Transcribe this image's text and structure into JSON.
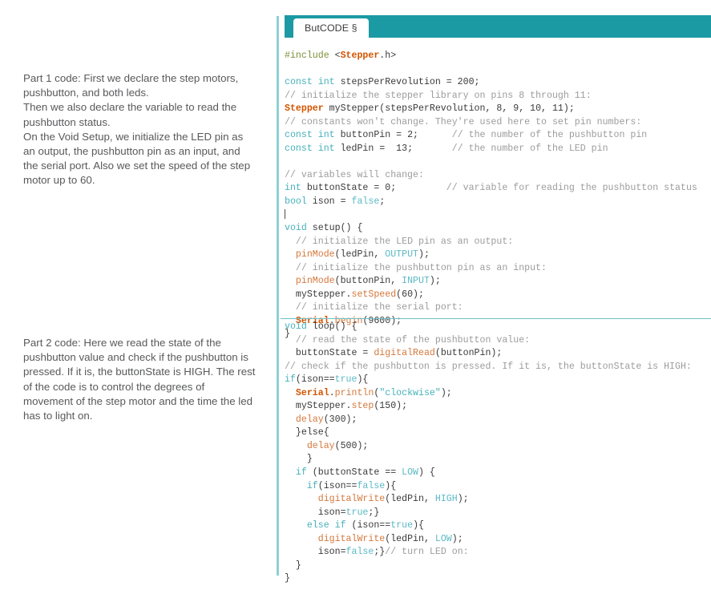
{
  "notes": {
    "part1": "Part 1 code: First we declare the step motors, pushbutton, and both leds.\nThen we also declare the variable to read the pushbutton status.\nOn the Void Setup, we initialize the LED pin as an output, the pushbutton pin as an input, and the serial port. Also we set the speed of the step motor up to 60.",
    "part2": "Part 2 code: Here we read the state of the pushbutton value and check if the pushbutton is pressed. If it is, the buttonState is HIGH. The rest of the code is to control the degrees of movement of the step motor and the time the led has to light on."
  },
  "tabs": {
    "active_label": "ButCODE §"
  },
  "colors": {
    "tab_bar": "#1b9aa3",
    "rail": "#8ecfd6",
    "divider": "#6cc0c5",
    "keyword": "#46b1bb",
    "type": "#d35400",
    "function": "#d4783c",
    "constant": "#5bb9c4",
    "string": "#46b1bb",
    "comment": "#9c9c9c",
    "preprocessor": "#7a8f3a",
    "text": "#3a3a3a",
    "note_text": "#58595b"
  },
  "code_block_1": [
    [
      {
        "t": "pre",
        "v": "#include "
      },
      {
        "t": "plain",
        "v": "<"
      },
      {
        "t": "type",
        "v": "Stepper"
      },
      {
        "t": "plain",
        "v": ".h>"
      }
    ],
    [],
    [
      {
        "t": "kw",
        "v": "const int"
      },
      {
        "t": "plain",
        "v": " stepsPerRevolution = 200;"
      }
    ],
    [
      {
        "t": "cmt",
        "v": "// initialize the stepper library on pins 8 through 11:"
      }
    ],
    [
      {
        "t": "type",
        "v": "Stepper"
      },
      {
        "t": "plain",
        "v": " myStepper(stepsPerRevolution, 8, 9, 10, 11);"
      }
    ],
    [
      {
        "t": "cmt",
        "v": "// constants won't change. They're used here to set pin numbers:"
      }
    ],
    [
      {
        "t": "kw",
        "v": "const int"
      },
      {
        "t": "plain",
        "v": " buttonPin = 2;      "
      },
      {
        "t": "cmt",
        "v": "// the number of the pushbutton pin"
      }
    ],
    [
      {
        "t": "kw",
        "v": "const int"
      },
      {
        "t": "plain",
        "v": " ledPin =  13;       "
      },
      {
        "t": "cmt",
        "v": "// the number of the LED pin"
      }
    ],
    [],
    [
      {
        "t": "cmt",
        "v": "// variables will change:"
      }
    ],
    [
      {
        "t": "kw",
        "v": "int"
      },
      {
        "t": "plain",
        "v": " buttonState = 0;         "
      },
      {
        "t": "cmt",
        "v": "// variable for reading the pushbutton status"
      }
    ],
    [
      {
        "t": "kw",
        "v": "bool"
      },
      {
        "t": "plain",
        "v": " ison = "
      },
      {
        "t": "const",
        "v": "false"
      },
      {
        "t": "plain",
        "v": ";"
      }
    ],
    [
      {
        "t": "caret",
        "v": ""
      }
    ],
    [
      {
        "t": "kw",
        "v": "void"
      },
      {
        "t": "plain",
        "v": " setup() {"
      }
    ],
    [
      {
        "t": "plain",
        "v": "  "
      },
      {
        "t": "cmt",
        "v": "// initialize the LED pin as an output:"
      }
    ],
    [
      {
        "t": "plain",
        "v": "  "
      },
      {
        "t": "fn",
        "v": "pinMode"
      },
      {
        "t": "plain",
        "v": "(ledPin, "
      },
      {
        "t": "const",
        "v": "OUTPUT"
      },
      {
        "t": "plain",
        "v": ");"
      }
    ],
    [
      {
        "t": "plain",
        "v": "  "
      },
      {
        "t": "cmt",
        "v": "// initialize the pushbutton pin as an input:"
      }
    ],
    [
      {
        "t": "plain",
        "v": "  "
      },
      {
        "t": "fn",
        "v": "pinMode"
      },
      {
        "t": "plain",
        "v": "(buttonPin, "
      },
      {
        "t": "const",
        "v": "INPUT"
      },
      {
        "t": "plain",
        "v": ");"
      }
    ],
    [
      {
        "t": "plain",
        "v": "  myStepper."
      },
      {
        "t": "fn",
        "v": "setSpeed"
      },
      {
        "t": "plain",
        "v": "(60);"
      }
    ],
    [
      {
        "t": "plain",
        "v": "  "
      },
      {
        "t": "cmt",
        "v": "// initialize the serial port:"
      }
    ],
    [
      {
        "t": "plain",
        "v": "  "
      },
      {
        "t": "type",
        "v": "Serial"
      },
      {
        "t": "plain",
        "v": "."
      },
      {
        "t": "fn",
        "v": "begin"
      },
      {
        "t": "plain",
        "v": "(9600);"
      }
    ],
    [
      {
        "t": "plain",
        "v": "}"
      }
    ]
  ],
  "code_block_2": [
    [
      {
        "t": "kw",
        "v": "void"
      },
      {
        "t": "plain",
        "v": " loop() {"
      }
    ],
    [
      {
        "t": "plain",
        "v": "  "
      },
      {
        "t": "cmt",
        "v": "// read the state of the pushbutton value:"
      }
    ],
    [
      {
        "t": "plain",
        "v": "  buttonState = "
      },
      {
        "t": "fn",
        "v": "digitalRead"
      },
      {
        "t": "plain",
        "v": "(buttonPin);"
      }
    ],
    [
      {
        "t": "cmt",
        "v": "// check if the pushbutton is pressed. If it is, the buttonState is HIGH:"
      }
    ],
    [
      {
        "t": "kw",
        "v": "if"
      },
      {
        "t": "plain",
        "v": "(ison=="
      },
      {
        "t": "const",
        "v": "true"
      },
      {
        "t": "plain",
        "v": "){"
      }
    ],
    [
      {
        "t": "plain",
        "v": "  "
      },
      {
        "t": "type",
        "v": "Serial"
      },
      {
        "t": "plain",
        "v": "."
      },
      {
        "t": "fn",
        "v": "println"
      },
      {
        "t": "plain",
        "v": "("
      },
      {
        "t": "str",
        "v": "\"clockwise\""
      },
      {
        "t": "plain",
        "v": ");"
      }
    ],
    [
      {
        "t": "plain",
        "v": "  myStepper."
      },
      {
        "t": "fn",
        "v": "step"
      },
      {
        "t": "plain",
        "v": "(150);"
      }
    ],
    [
      {
        "t": "plain",
        "v": "  "
      },
      {
        "t": "fn",
        "v": "delay"
      },
      {
        "t": "plain",
        "v": "(300);"
      }
    ],
    [
      {
        "t": "plain",
        "v": "  }else{"
      }
    ],
    [
      {
        "t": "plain",
        "v": "    "
      },
      {
        "t": "fn",
        "v": "delay"
      },
      {
        "t": "plain",
        "v": "(500);"
      }
    ],
    [
      {
        "t": "plain",
        "v": "    }"
      }
    ],
    [
      {
        "t": "plain",
        "v": "  "
      },
      {
        "t": "kw",
        "v": "if"
      },
      {
        "t": "plain",
        "v": " (buttonState == "
      },
      {
        "t": "const",
        "v": "LOW"
      },
      {
        "t": "plain",
        "v": ") {"
      }
    ],
    [
      {
        "t": "plain",
        "v": "    "
      },
      {
        "t": "kw",
        "v": "if"
      },
      {
        "t": "plain",
        "v": "(ison=="
      },
      {
        "t": "const",
        "v": "false"
      },
      {
        "t": "plain",
        "v": "){"
      }
    ],
    [
      {
        "t": "plain",
        "v": "      "
      },
      {
        "t": "fn",
        "v": "digitalWrite"
      },
      {
        "t": "plain",
        "v": "(ledPin, "
      },
      {
        "t": "const",
        "v": "HIGH"
      },
      {
        "t": "plain",
        "v": ");"
      }
    ],
    [
      {
        "t": "plain",
        "v": "      ison="
      },
      {
        "t": "const",
        "v": "true"
      },
      {
        "t": "plain",
        "v": ";}"
      }
    ],
    [
      {
        "t": "plain",
        "v": "    "
      },
      {
        "t": "kw",
        "v": "else if"
      },
      {
        "t": "plain",
        "v": " (ison=="
      },
      {
        "t": "const",
        "v": "true"
      },
      {
        "t": "plain",
        "v": "){"
      }
    ],
    [
      {
        "t": "plain",
        "v": "      "
      },
      {
        "t": "fn",
        "v": "digitalWrite"
      },
      {
        "t": "plain",
        "v": "(ledPin, "
      },
      {
        "t": "const",
        "v": "LOW"
      },
      {
        "t": "plain",
        "v": ");"
      }
    ],
    [
      {
        "t": "plain",
        "v": "      ison="
      },
      {
        "t": "const",
        "v": "false"
      },
      {
        "t": "plain",
        "v": ";}"
      },
      {
        "t": "cmt",
        "v": "// turn LED on:"
      }
    ],
    [
      {
        "t": "plain",
        "v": "  }"
      }
    ],
    [
      {
        "t": "plain",
        "v": "}"
      }
    ]
  ]
}
